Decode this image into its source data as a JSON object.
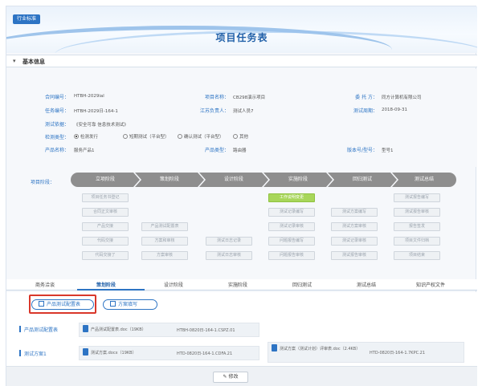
{
  "header": {
    "badge": "行业标准",
    "title": "项目任务表"
  },
  "basic_info": {
    "section_title": "基本信息",
    "fields": {
      "contract_no_label": "合同编号：",
      "contract_no_value": "HTBH-2029ial",
      "project_name_label": "项目名称：",
      "project_name_value": "CB298演示项目",
      "delegator_label": "委 托 方：",
      "delegator_value": "同方计算机有限公司",
      "task_no_label": "任务编号：",
      "task_no_value": "HTBH-2029日-164-1",
      "contact_label": "江苏负责人：",
      "contact_value": "测试人员7",
      "test_date_label": "测试周期：",
      "test_date_value": "2018-09-31",
      "basis_label": "测试依据：",
      "basis_value": "《安全可靠 信息技术测试》",
      "test_type_label": "检测类型：",
      "test_type_options": [
        "检测发行",
        "短期测试（平台型）",
        "确认测试（平台型）",
        "其他"
      ],
      "product_name_label": "产品名称：",
      "product_name_value": "服务产品1",
      "product_type_label": "产品类型：",
      "product_type_value": "路由器",
      "version_label": "版本号/型号：",
      "version_value": "型号1"
    }
  },
  "process": {
    "label": "项目阶段：",
    "stages": [
      "立项阶段",
      "策划阶段",
      "设计阶段",
      "实施阶段",
      "回归测试",
      "测试总结"
    ],
    "tasks": {
      "c0": [
        "项目任务书登记",
        "合同正文审核",
        "产品交接",
        "代码交接",
        "代码交接了"
      ],
      "c1": [
        "产品测试配置表",
        "方案和审核",
        "方案审核"
      ],
      "c2": [
        "测试日志记录",
        "测试日志审核"
      ],
      "c3": [
        "工作说明变更",
        "测试记录编写",
        "测试记录审核",
        "问题报告编写",
        "问题报告审核"
      ],
      "c4": [
        "测试方案编写",
        "测试方案审核",
        "测试记录审核",
        "测试报告审核"
      ],
      "c5": [
        "测试报告编写",
        "测试报告审核",
        "报告签发",
        "项目文件归档",
        "项目结束"
      ]
    }
  },
  "tabs": [
    "商务洽谈",
    "策划阶段",
    "设计阶段",
    "实施阶段",
    "回归测试",
    "测试总结",
    "知识产权文件"
  ],
  "actions": {
    "btn1": "产品测试配置表",
    "btn2": "方案填写"
  },
  "files": {
    "row1_label": "产品测试配置表",
    "row1_file": "产品测试配置表.doc（19KB）",
    "row1_code": "HTBH-0820日-164-1.CSPZ.01",
    "row2_label": "测试方案1",
    "row2_file": "测试方案.docx（19KB）",
    "row2_code": "HTD-0820日-164-1.CDFA.21",
    "row2_file2": "测试方案（测试计划）评审表.doc（2.4KB）",
    "row2_code2": "HTD-0820日-164-1.7KPC.21"
  },
  "footer": {
    "edit_label": "修改"
  }
}
